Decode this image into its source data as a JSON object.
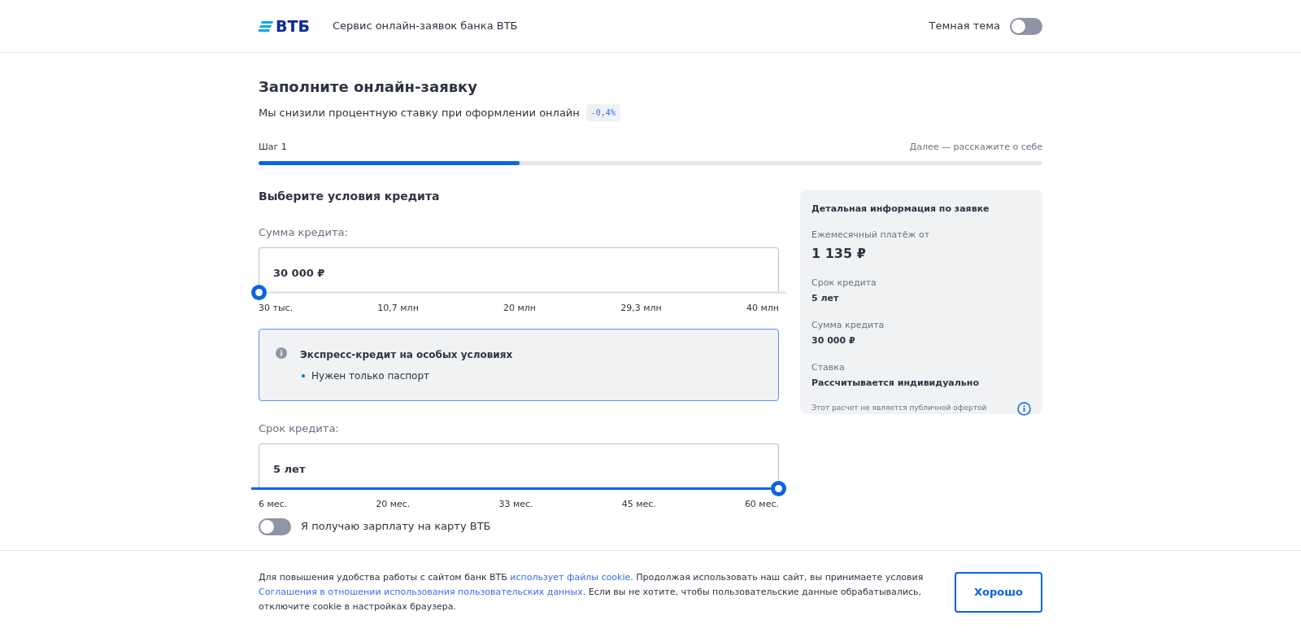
{
  "header": {
    "logo": "ВТБ",
    "service_title": "Сервис онлайн-заявок банка ВТБ",
    "theme_toggle": {
      "label": "Темная тема",
      "on": false
    }
  },
  "page": {
    "title": "Заполните онлайн-заявку",
    "subtitle": "Мы снизили процентную ставку при оформлении онлайн",
    "rate_badge": "-0,4%"
  },
  "progress": {
    "step": "Шаг 1",
    "next": "Далее — расскажите о себе",
    "level": 0.333
  },
  "form": {
    "heading": "Выберите условия кредита",
    "sliders": [
      {
        "label": "Сумма кредита:",
        "value": "30 000 ₽",
        "level": 0,
        "ticks": [
          "30 тыс.",
          "10,7 млн",
          "20 млн",
          "29,3 млн",
          "40 млн"
        ]
      },
      {
        "label": "Срок кредита:",
        "value": "5 лет",
        "level": 1,
        "ticks": [
          "6 мес.",
          "20 мес.",
          "33 мес.",
          "45 мес.",
          "60 мес."
        ]
      }
    ],
    "notice": {
      "title": "Экспресс-кредит на особых условиях",
      "items": [
        "Нужен только паспорт"
      ]
    },
    "salary_toggle": {
      "label": "Я получаю зарплату на карту ВТБ",
      "on": false
    }
  },
  "summary": {
    "title": "Детальная информация по заявке",
    "items": [
      {
        "label": "Ежемесячный платёж от",
        "value": "1 135 ₽",
        "kind": "large"
      },
      {
        "label": "Срок кредита",
        "value": "5 лет",
        "kind": "small"
      },
      {
        "label": "Сумма кредита",
        "value": "30 000 ₽",
        "kind": "small"
      },
      {
        "label": "Ставка",
        "value": "Рассчитывается индивидуально",
        "kind": "small"
      }
    ],
    "disclaimer": "Этот расчет не является публичной офертой"
  },
  "cookie_banner": {
    "text": [
      {
        "text": "Для повышения удобства работы с сайтом банк ВТБ ",
        "kind": "plain"
      },
      {
        "text": "использует файлы cookie",
        "kind": "link"
      },
      {
        "text": ". Продолжая использовать наш сайт, вы принимаете условия ",
        "kind": "plain"
      },
      {
        "text": "Соглашения в отношении использования пользовательских данных",
        "kind": "link"
      },
      {
        "text": ". Если вы не хотите, чтобы пользовательские данные обрабатывались, отключите cookie в настройках браузера.",
        "kind": "plain"
      }
    ],
    "button": "Хорошо"
  }
}
